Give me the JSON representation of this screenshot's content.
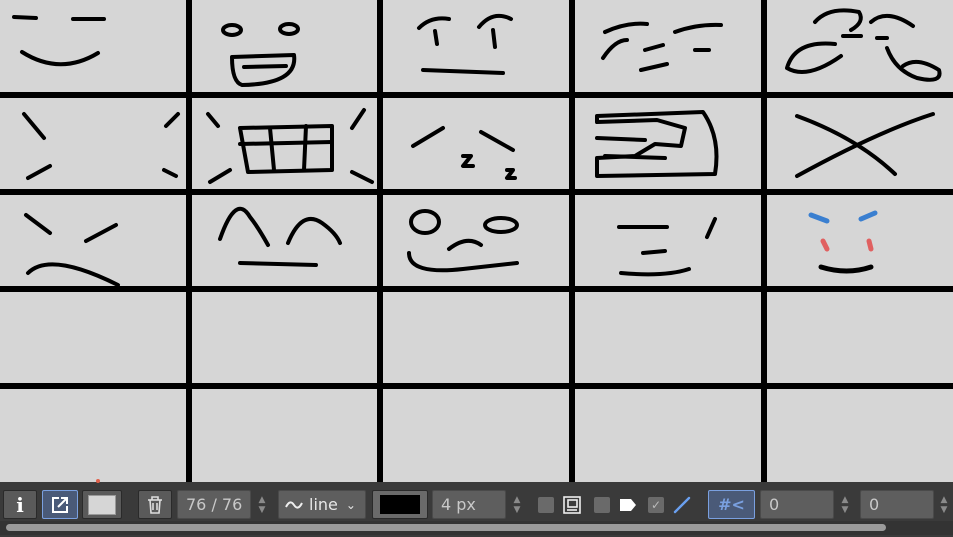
{
  "toolbar": {
    "frame_counter": "76 / 76",
    "brush_type": "line",
    "brush_size": "4 px",
    "offset_x": "0",
    "offset_y": "0",
    "grid_toggle_glyph": "#<"
  },
  "icons": {
    "info": "info-icon",
    "export": "export-icon",
    "trash": "trash-icon",
    "wave": "wave-icon",
    "onion": "onion-skin-icon",
    "tag": "tag-icon",
    "check": "check-icon",
    "pen": "pen-icon",
    "grid": "grid-icon"
  },
  "colors": {
    "cell_bg": "#d6d6d6",
    "stroke": "#000000",
    "brush_color": "#000000",
    "accent": "#7aa0e0",
    "blue_mark": "#3a7fd0",
    "red_mark": "#e06060"
  }
}
